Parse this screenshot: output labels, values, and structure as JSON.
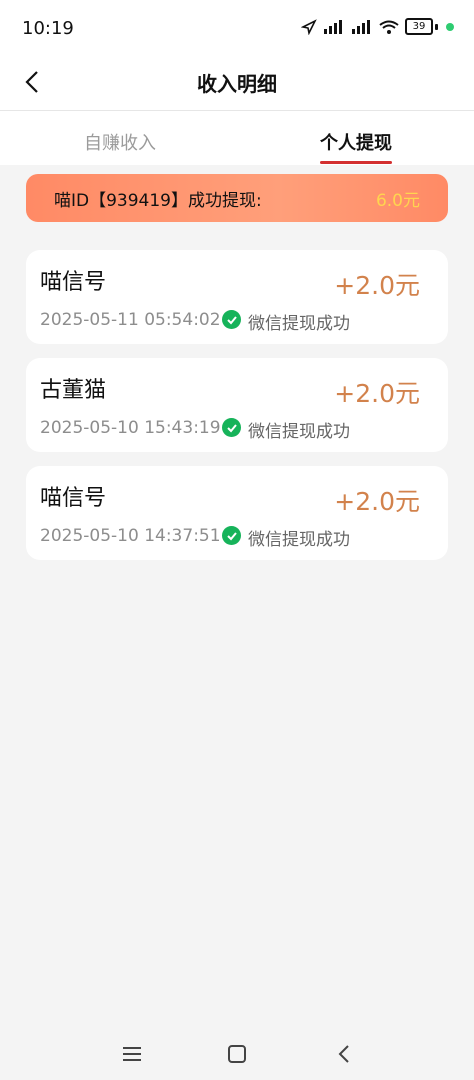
{
  "status": {
    "time": "10:19",
    "battery": "39"
  },
  "header": {
    "title": "收入明细"
  },
  "tabs": [
    {
      "label": "自赚收入"
    },
    {
      "label": "个人提现"
    }
  ],
  "banner": {
    "text": "喵ID【939419】成功提现:",
    "amount": "6.0元"
  },
  "items": [
    {
      "name": "喵信号",
      "amount": "+2.0元",
      "time": "2025-05-11 05:54:02",
      "status": "微信提现成功"
    },
    {
      "name": "古董猫",
      "amount": "+2.0元",
      "time": "2025-05-10 15:43:19",
      "status": "微信提现成功"
    },
    {
      "name": "喵信号",
      "amount": "+2.0元",
      "time": "2025-05-10 14:37:51",
      "status": "微信提现成功"
    }
  ],
  "colors": {
    "accent": "#d32f2f",
    "amount": "#d2824c",
    "success": "#16b35a",
    "banner": "#ff8a65"
  }
}
